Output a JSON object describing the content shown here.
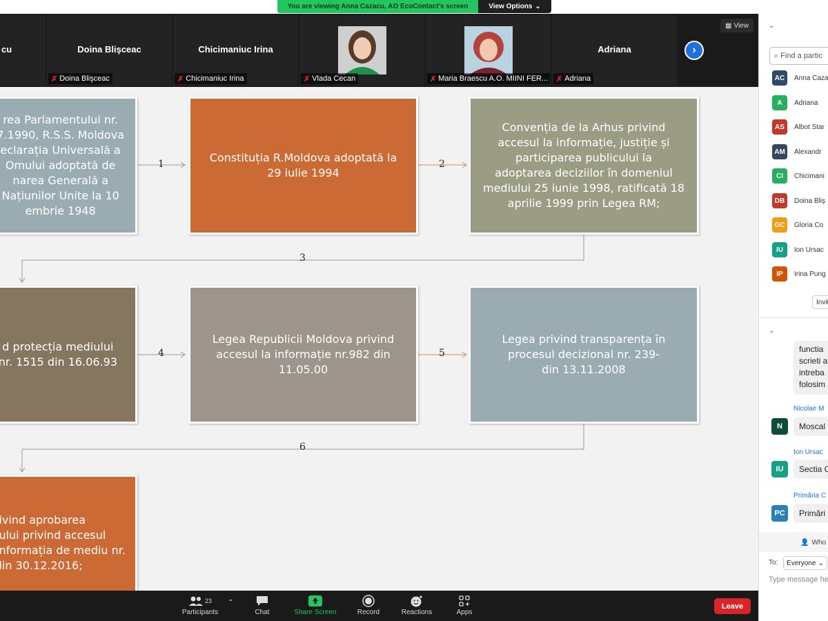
{
  "banner": {
    "viewing_text": "You are viewing Anna Cazacu, AO EcoContact's screen",
    "view_options": "View Options"
  },
  "video_strip": {
    "tiles": [
      {
        "name": "cu",
        "label": ""
      },
      {
        "name": "Doina Blişceac",
        "label": "Doina Blişceac"
      },
      {
        "name": "Chicimaniuc Irina",
        "label": "Chicimaniuc Irina"
      },
      {
        "name": "",
        "label": "Vlada Cecan"
      },
      {
        "name": "",
        "label": "Maria Braescu A.O. MIINI FER..."
      },
      {
        "name": "Adriana",
        "label": "Adriana"
      }
    ],
    "view_label": "View"
  },
  "slide": {
    "boxes": [
      {
        "lines": [
          "rea Parlamentului nr.",
          "7.1990, R.S.S. Moldova",
          "eclarația Universală a",
          "Omului adoptată de",
          "narea Generală a",
          "Națiunilor Unite la 10",
          "embrie 1948"
        ],
        "color": "#9aacb2"
      },
      {
        "lines": [
          "Constituția R.Moldova adoptată la",
          "29 iulie 1994"
        ],
        "color": "#cc6a35"
      },
      {
        "lines": [
          "Convenția de la Arhus privind",
          "accesul la informație, justiție și",
          "participarea publicului la",
          "adoptarea deciziilor  în domeniul",
          "mediului 25 iunie 1998, ratificată 18",
          "aprilie 1999 prin Legea RM;"
        ],
        "color": "#9a9c84"
      },
      {
        "lines": [
          "d protecția mediului",
          "nr. 1515 din 16.06.93"
        ],
        "color": "#857660"
      },
      {
        "lines": [
          "Legea Republicii Moldova privind",
          "accesul la informație nr.982 din",
          "11.05.00"
        ],
        "color": "#9d948b"
      },
      {
        "lines": [
          "Legea privind transparența în",
          "procesul decizional nr. 239-",
          "din  13.11.2008"
        ],
        "color": "#9aacb2"
      },
      {
        "lines": [
          "ivind aprobarea",
          "ului privind accesul",
          "nformația de mediu nr.",
          "lin 30.12.2016;"
        ],
        "color": "#cc6a35"
      }
    ],
    "arrow_labels": [
      "1",
      "2",
      "3",
      "4",
      "5",
      "6"
    ]
  },
  "toolbar": {
    "participants_label": "Participants",
    "participants_count": "23",
    "chat_label": "Chat",
    "share_label": "Share Screen",
    "record_label": "Record",
    "reactions_label": "Reactions",
    "apps_label": "Apps",
    "leave_label": "Leave"
  },
  "panel": {
    "find_placeholder": "Find a partic",
    "participants": [
      {
        "initials": "AC",
        "name": "Anna Caza",
        "color": "#2f4a67"
      },
      {
        "initials": "A",
        "name": "Adriana",
        "color": "#27ae60"
      },
      {
        "initials": "AS",
        "name": "Albot Star",
        "color": "#c0392b"
      },
      {
        "initials": "AM",
        "name": "Alexandr",
        "color": "#34495e"
      },
      {
        "initials": "CI",
        "name": "Chicimani",
        "color": "#27ae60"
      },
      {
        "initials": "DB",
        "name": "Doina Bliş",
        "color": "#c0392b"
      },
      {
        "initials": "GC",
        "name": "Gloria Co",
        "color": "#f39c12"
      },
      {
        "initials": "IU",
        "name": "Ion Ursac",
        "color": "#16a085"
      },
      {
        "initials": "IP",
        "name": "Irina Pung",
        "color": "#d35400"
      }
    ],
    "invite_label": "Invit",
    "chat_snippet": [
      "functia",
      "scrieti a",
      "intreba",
      "folosim"
    ],
    "messages": [
      {
        "sender": "Nicolae M",
        "initials": "N",
        "text": "Moscal",
        "color": "#0d4d3a"
      },
      {
        "sender": "Ion Ursac",
        "initials": "IU",
        "text": "Sectia C",
        "color": "#16a085"
      },
      {
        "sender": "Primăria C",
        "initials": "PC",
        "text": "Primări",
        "color": "#2980b9"
      }
    ],
    "who_label": "Who",
    "to_label": "To:",
    "to_value": "Everyone",
    "message_placeholder": "Type message he"
  }
}
